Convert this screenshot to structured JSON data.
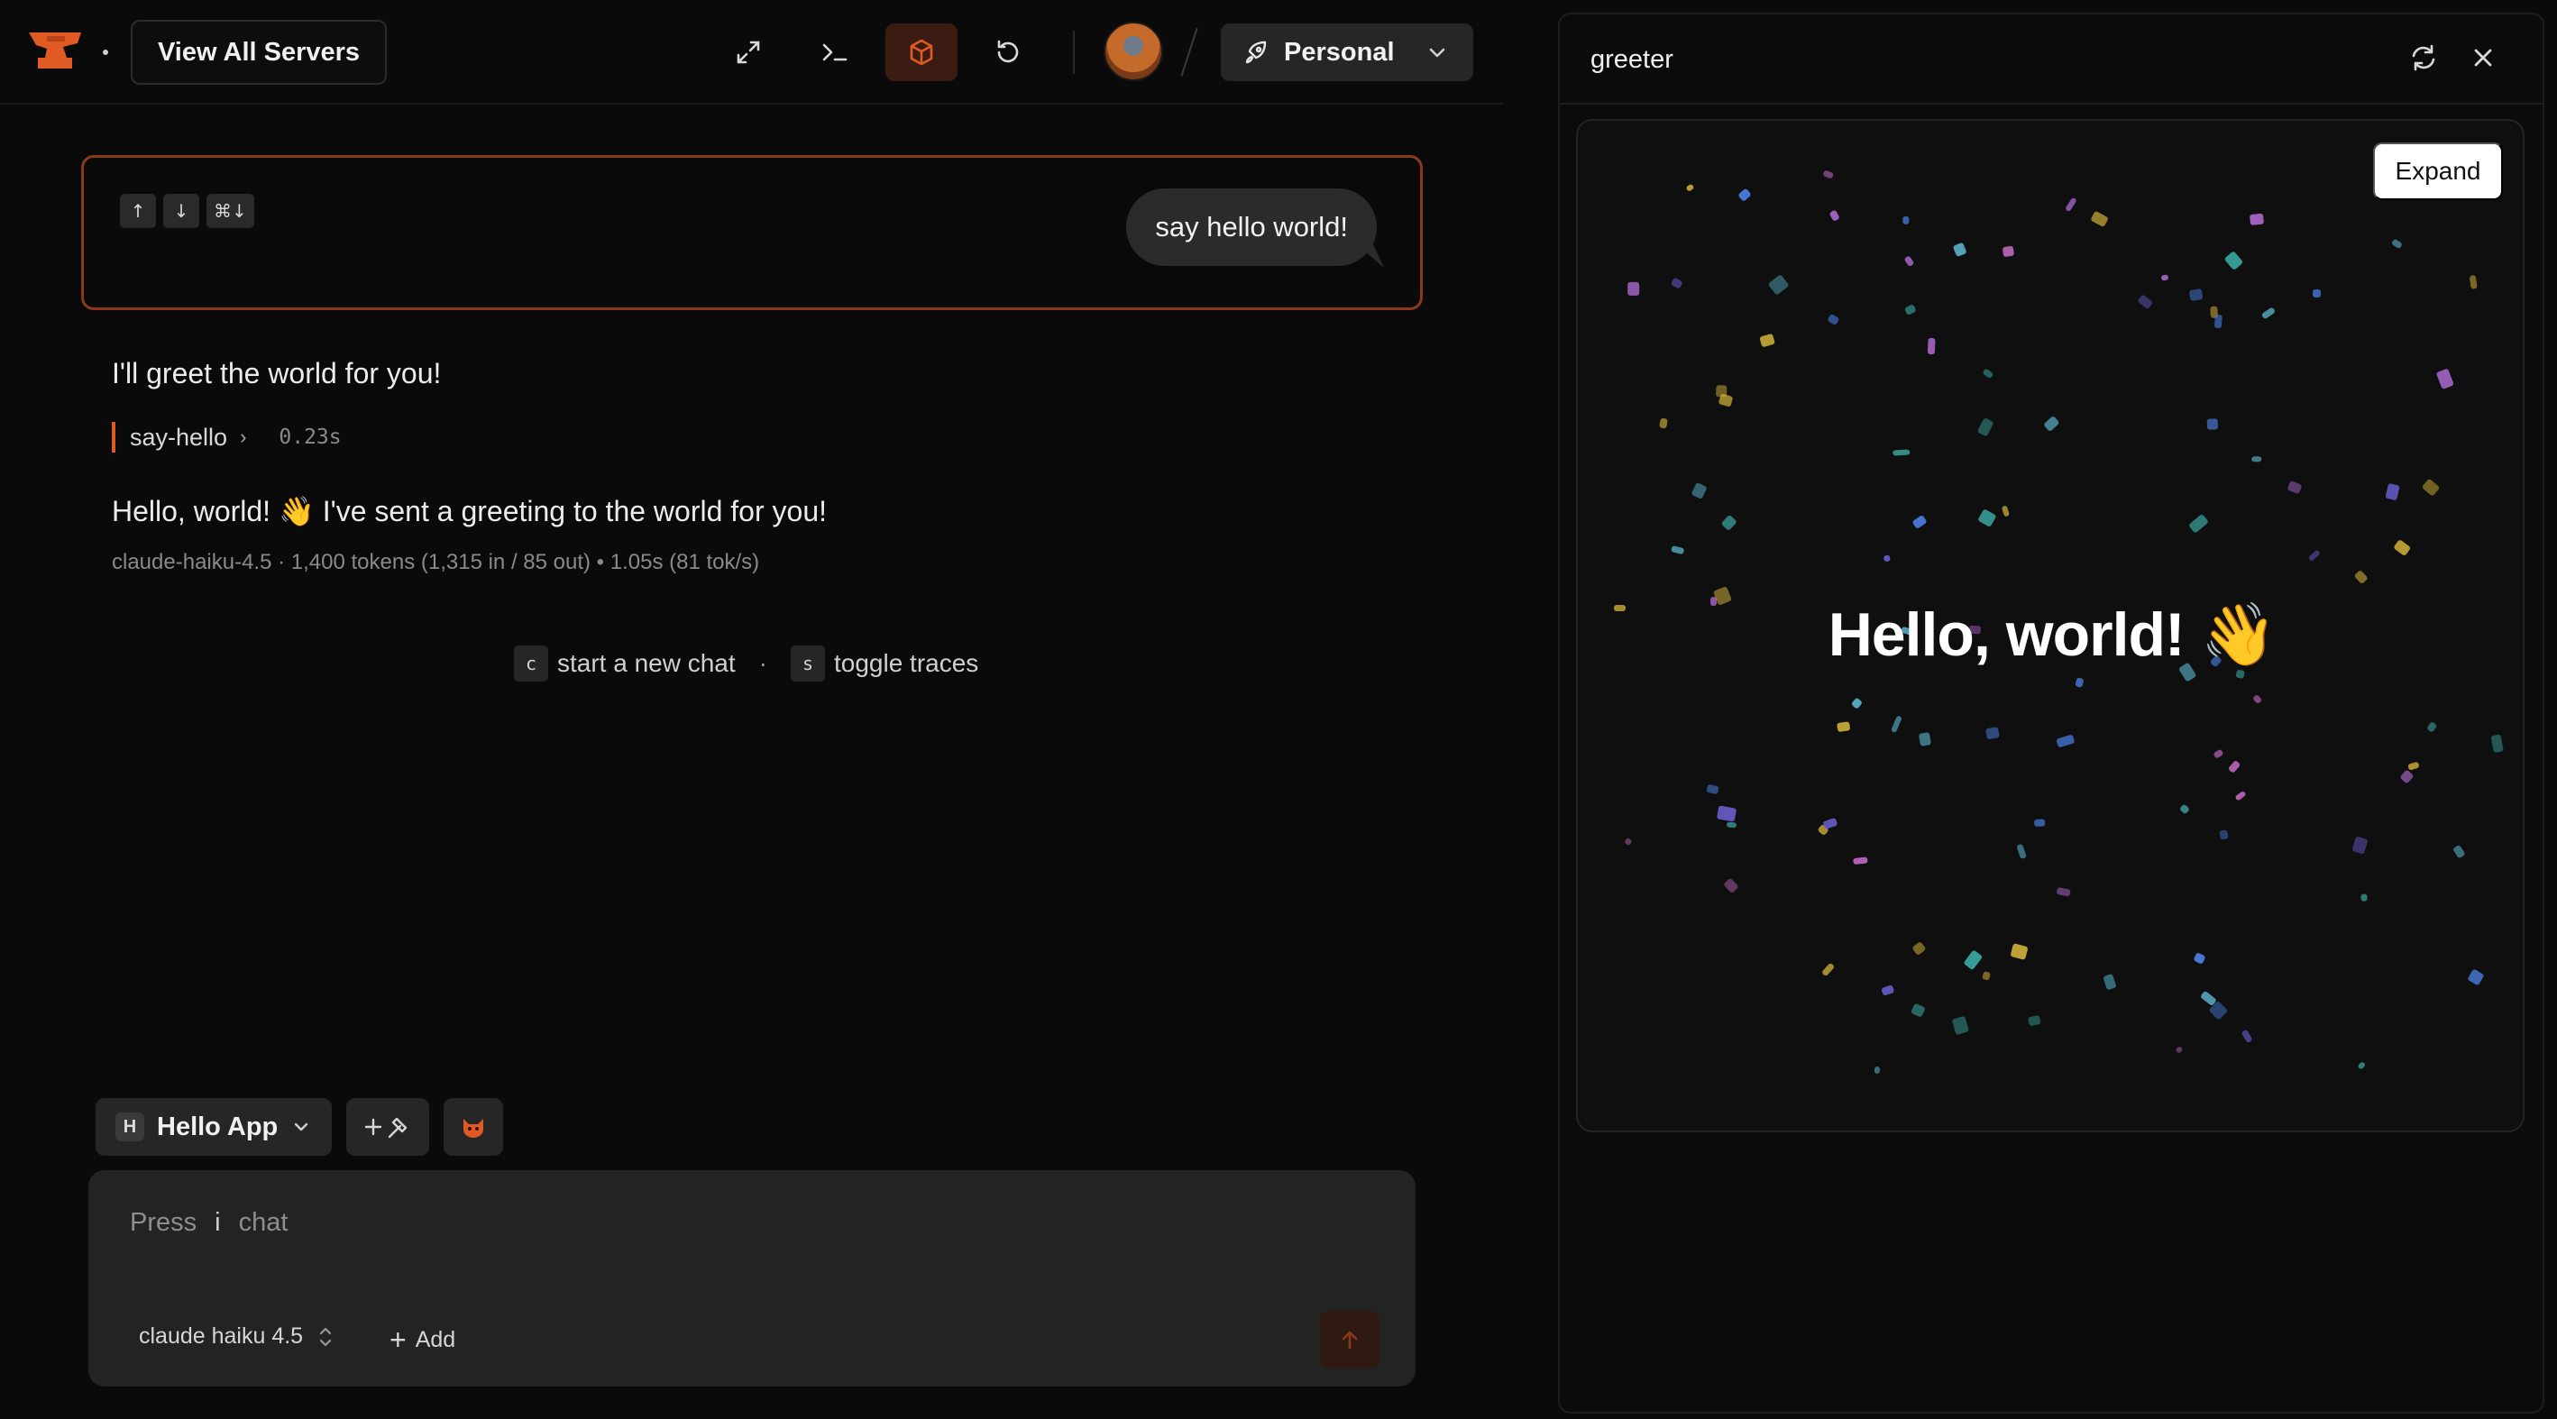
{
  "topbar": {
    "servers_button": "View All Servers",
    "workspace": "Personal",
    "icons": [
      "expand-icon",
      "terminal-icon",
      "box-icon",
      "reload-icon"
    ],
    "accent_color": "#e05a24"
  },
  "chat": {
    "nav_keys": [
      "↑",
      "↓",
      "⌘↓"
    ],
    "user_message": "say hello world!",
    "assistant_intro": "I'll greet the world for you!",
    "tool_call": {
      "name": "say-hello",
      "duration": "0.23s"
    },
    "assistant_reply": "Hello, world! 👋 I've sent a greeting to the world for you!",
    "meta": "claude-haiku-4.5 · 1,400 tokens (1,315 in / 85 out) • 1.05s (81 tok/s)",
    "hints": [
      {
        "key": "c",
        "label": "start a new chat"
      },
      {
        "key": "s",
        "label": "toggle traces"
      }
    ],
    "hint_separator": "·"
  },
  "composer": {
    "app_badge": "H",
    "app_name": "Hello App",
    "placeholder_prefix": "Press",
    "placeholder_key": "i",
    "placeholder_suffix": "chat",
    "model": "claude haiku 4.5",
    "add_label": "Add"
  },
  "panel": {
    "title": "greeter",
    "expand_label": "Expand",
    "hello_text": "Hello, world!",
    "hello_emoji": "👋"
  }
}
